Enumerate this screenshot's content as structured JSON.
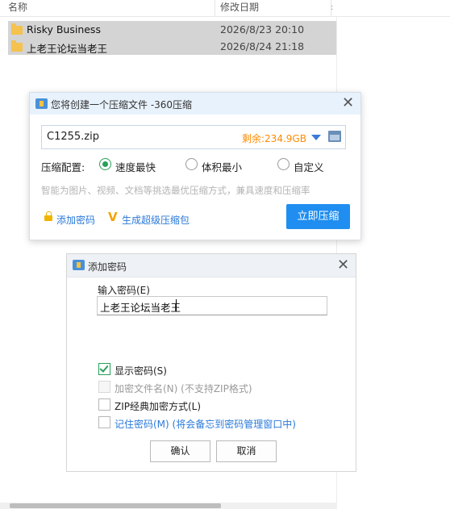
{
  "explorer": {
    "columns": {
      "name": "名称",
      "date": "修改日期"
    },
    "rows": [
      {
        "name": "Risky Business",
        "date": "2026/8/23 20:10"
      },
      {
        "name": "上老王论坛当老王",
        "date": "2026/8/24 21:18"
      }
    ]
  },
  "compress_dialog": {
    "title": "您将创建一个压缩文件 -360压缩",
    "file_name": "C1255.zip",
    "free_space": "剩余:234.9GB",
    "config_label": "压缩配置:",
    "options": [
      "速度最快",
      "体积最小",
      "自定义"
    ],
    "selected_option": "速度最快",
    "hint": "智能为图片、视频、文档等挑选最优压缩方式，兼具速度和压缩率",
    "add_password": "添加密码",
    "super_package": "生成超级压缩包",
    "compress_now": "立即压缩"
  },
  "password_dialog": {
    "title": "添加密码",
    "input_label": "输入密码(E)",
    "password_value": "上老王论坛当老王",
    "options": [
      {
        "label": "显示密码(S)",
        "checked": true,
        "disabled": false
      },
      {
        "label": "加密文件名(N) (不支持ZIP格式)",
        "checked": false,
        "disabled": true
      },
      {
        "label": "ZIP经典加密方式(L)",
        "checked": false,
        "disabled": false
      },
      {
        "label": "记住密码(M) (将会备忘到密码管理窗口中)",
        "checked": false,
        "disabled": false
      }
    ],
    "ok": "确认",
    "cancel": "取消"
  },
  "colors": {
    "accent": "#1f8ef0",
    "green": "#27a05a",
    "orange": "#ff8a00",
    "folder": "#f4c24d"
  },
  "icons": [
    "folder-icon",
    "archive-icon",
    "close-icon",
    "dropdown-arrow-icon",
    "browse-folder-icon",
    "lock-icon",
    "v-icon",
    "checkmark-icon"
  ]
}
